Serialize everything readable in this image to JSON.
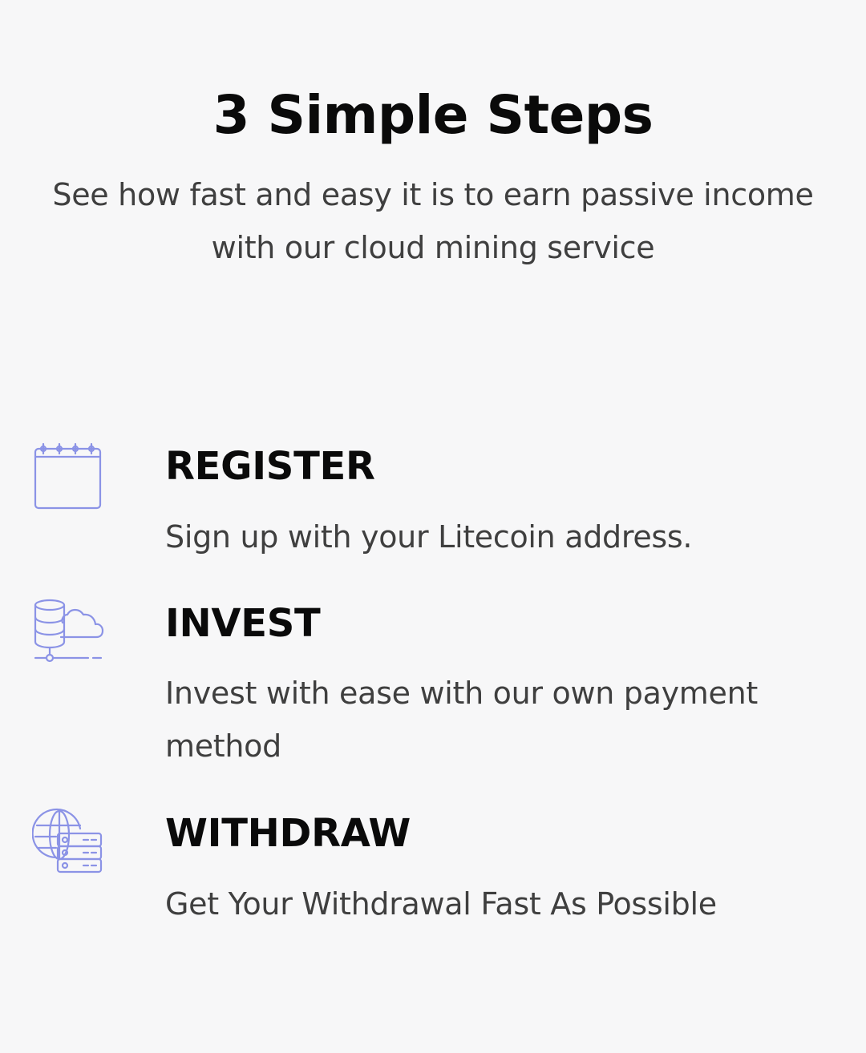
{
  "header": {
    "title": "3 Simple Steps",
    "subtitle": "See how fast and easy it is to earn passive income with our cloud mining service"
  },
  "steps": [
    {
      "icon": "calendar-icon",
      "title": "REGISTER",
      "description": "Sign up with your Litecoin address."
    },
    {
      "icon": "database-cloud-icon",
      "title": "INVEST",
      "description": "Invest with ease with our own payment method"
    },
    {
      "icon": "globe-server-icon",
      "title": "WITHDRAW",
      "description": "Get Your Withdrawal Fast As Possible"
    }
  ],
  "colors": {
    "icon_stroke": "#8b93e6",
    "heading": "#0a0a0a",
    "body_text": "#3f3f3f",
    "background": "#f7f7f8"
  }
}
